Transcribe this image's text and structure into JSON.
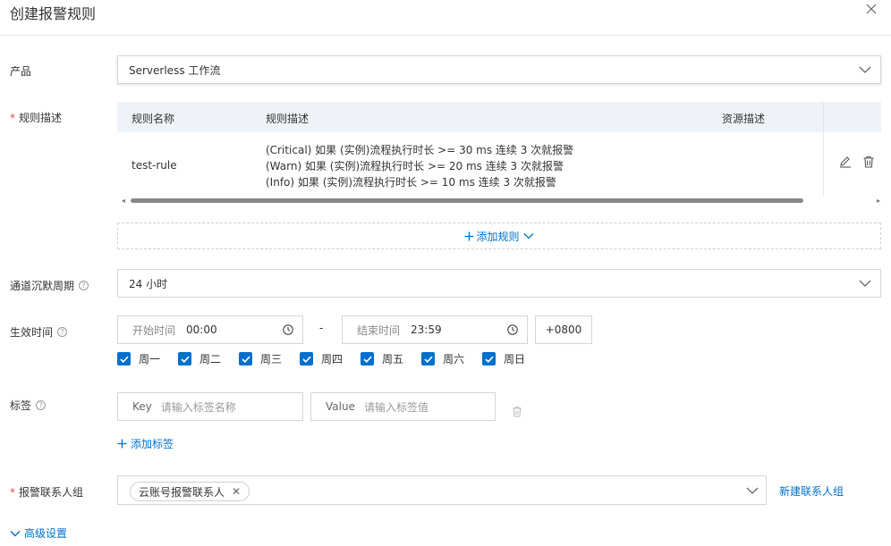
{
  "dialog": {
    "title": "创建报警规则"
  },
  "product": {
    "label": "产品",
    "value": "Serverless 工作流"
  },
  "rules": {
    "label": "规则描述",
    "headers": {
      "name": "规则名称",
      "desc": "规则描述",
      "resource": "资源描述"
    },
    "row": {
      "name": "test-rule",
      "desc": [
        "(Critical) 如果 (实例)流程执行时长 >= 30 ms 连续 3 次就报警",
        "(Warn) 如果 (实例)流程执行时长 >= 20 ms 连续 3 次就报警",
        "(Info) 如果 (实例)流程执行时长 >= 10 ms 连续 3 次就报警"
      ]
    },
    "add_rule": "添加规则"
  },
  "silence": {
    "label": "通道沉默周期",
    "value": "24 小时"
  },
  "effective": {
    "label": "生效时间",
    "start_placeholder": "开始时间",
    "start_value": "00:00",
    "separator": "-",
    "end_placeholder": "结束时间",
    "end_value": "23:59",
    "timezone": "+0800",
    "days": [
      "周一",
      "周二",
      "周三",
      "周四",
      "周五",
      "周六",
      "周日"
    ]
  },
  "tags": {
    "label": "标签",
    "key_label": "Key",
    "key_placeholder": "请输入标签名称",
    "value_label": "Value",
    "value_placeholder": "请输入标签值",
    "add_tag": "添加标签"
  },
  "contacts": {
    "label": "报警联系人组",
    "chip": "云账号报警联系人",
    "new_group": "新建联系人组"
  },
  "advanced": {
    "label": "高级设置"
  },
  "colors": {
    "accent": "#0070cc",
    "required": "#e34b4b"
  }
}
